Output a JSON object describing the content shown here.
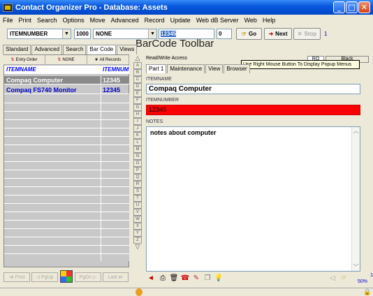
{
  "window": {
    "title": "Contact Organizer Pro - Database: Assets"
  },
  "menu": [
    "File",
    "Print",
    "Search",
    "Options",
    "Move",
    "Advanced",
    "Record",
    "Update",
    "Web dB Server",
    "Web",
    "Help"
  ],
  "toolbar": {
    "field_select": "ITEMNUMBER",
    "count": "1000",
    "filter_select": "NONE",
    "search_value": "12345",
    "record_field": "0",
    "go_label": "Go",
    "next_label": "Next",
    "stop_label": "Stop",
    "result_count": "1"
  },
  "barcode_title": "BarCode Toolbar",
  "left_tabs": [
    "Standard",
    "Advanced",
    "Search",
    "Bar Code",
    "Views"
  ],
  "left_active_tab": "Bar Code",
  "sort_buttons": [
    "Entry Order",
    "NONE",
    "All Records"
  ],
  "list": {
    "columns": [
      "ITEMNAME",
      "ITEMNUM"
    ],
    "rows": [
      {
        "name": "Compaq Computer",
        "num": "12345"
      },
      {
        "name": "Compaq FS740 Monitor",
        "num": "12345"
      }
    ]
  },
  "left_nav": [
    "First",
    "PgUp",
    "PgDn",
    "Last"
  ],
  "alpha": [
    "A",
    "B",
    "C",
    "D",
    "E",
    "F",
    "G",
    "H",
    "I",
    "J",
    "K",
    "L",
    "M",
    "N",
    "O",
    "P",
    "Q",
    "R",
    "S",
    "T",
    "U",
    "V",
    "W",
    "X",
    "Y",
    "Z"
  ],
  "access_label": "Read/Write Access",
  "ro_label": "RO",
  "black_label": "Black",
  "tooltip": "Use Right Mouse Button To Display Popup Menus",
  "right_tabs": [
    "Part 1",
    "Maintenance",
    "View",
    "Browser"
  ],
  "fields": {
    "itemname_label": "ITEMNAME",
    "itemname_value": "Compaq Computer",
    "itemnumber_label": "ITEMNUMBER",
    "itemnumber_value": "12345",
    "notes_label": "NOTES",
    "notes_value": "notes about computer"
  },
  "status": {
    "record": "1",
    "zoom": "50%"
  },
  "colors": {
    "title_bar": "#0a5ae0",
    "selected_row": "#8a8a8a",
    "itemnumber_bg": "#ff0000",
    "list_text": "#0000cc"
  }
}
